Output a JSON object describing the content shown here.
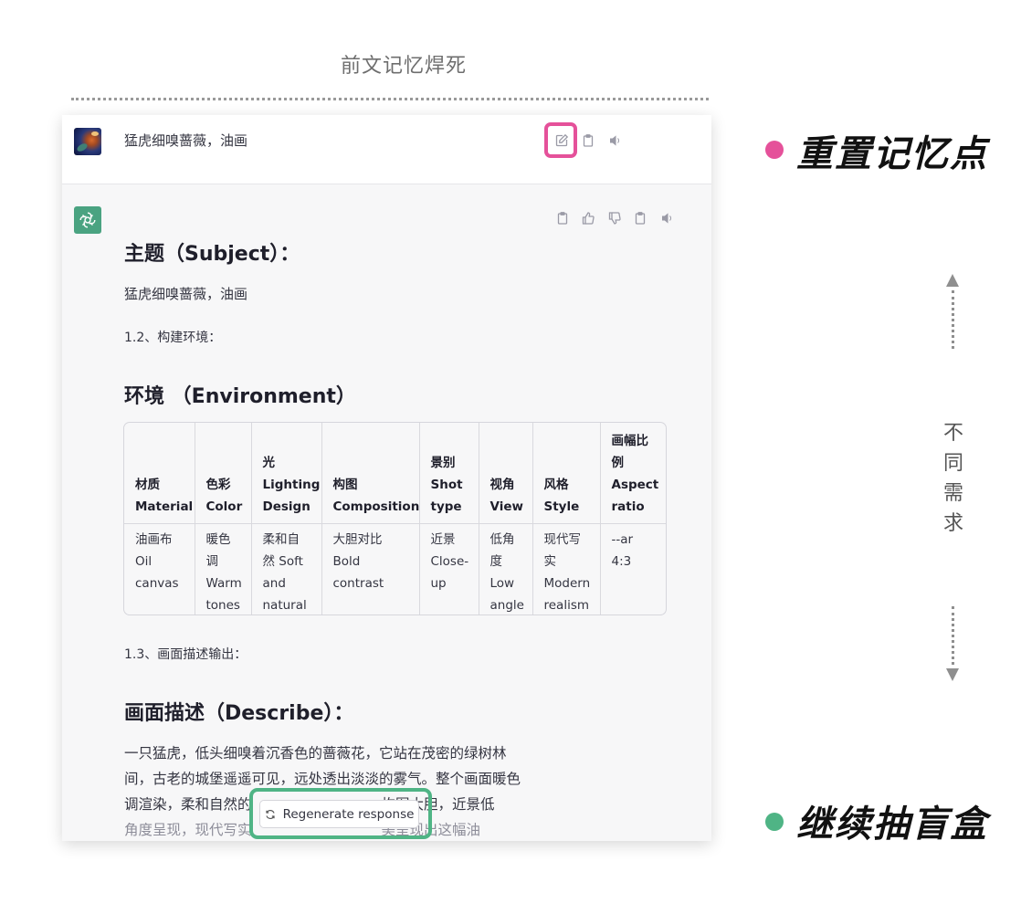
{
  "top_caption": "前文记忆焊死",
  "user_message": {
    "text": "猛虎细嗅蔷薇，油画"
  },
  "assistant": {
    "heading_subject": "主题（Subject）：",
    "subject_text": "猛虎细嗅蔷薇，油画",
    "step_1_2": "1.2、构建环境：",
    "heading_environment": "环境 （Environment）",
    "table": {
      "headers": [
        "材质\nMaterial",
        "色彩\nColor",
        "光\nLighting\nDesign",
        "构图\nComposition",
        "景别\nShot\ntype",
        "视角\nView",
        "风格\nStyle",
        "画幅比\n例\nAspect\nratio"
      ],
      "row": [
        "油画布\nOil\ncanvas",
        "暖色\n调\nWarm\ntones",
        "柔和自\n然 Soft\nand\nnatural",
        "大胆对比\nBold\ncontrast",
        "近景\nClose-\nup",
        "低角\n度\nLow\nangle",
        "现代写\n实\nModern\nrealism",
        "--ar\n4:3"
      ]
    },
    "step_1_3": "1.3、画面描述输出：",
    "heading_describe": "画面描述（Describe）：",
    "describe_line1": "一只猛虎，低头细嗅着沉香色的蔷薇花，它站在茂密的绿树林",
    "describe_line2": "间，古老的城堡遥遥可见，远处透出淡淡的雾气。整个画面暖色",
    "describe_line3_a": "调渲染，柔和自然的",
    "describe_line3_b": "构图大胆，近景低",
    "describe_line4": "角度呈现，现代写实",
    "describe_line4_b": "美呈现出这幅油"
  },
  "regenerate_button": "Regenerate response",
  "annotations": {
    "reset_memory": "重置记忆点",
    "continue_blind_box": "继续抽盲盒",
    "different_needs": [
      "不",
      "同",
      "需",
      "求"
    ],
    "pink": "#e5519a",
    "green": "#4fb485"
  }
}
